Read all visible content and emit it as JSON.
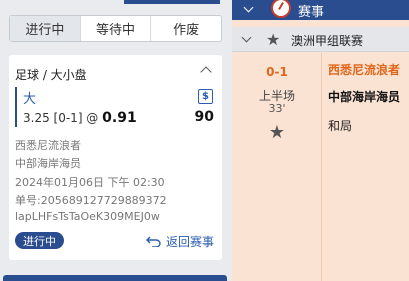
{
  "left_panel": {
    "tabs": [
      {
        "label": "进行中"
      },
      {
        "label": "等待中"
      },
      {
        "label": "作废"
      }
    ],
    "bet": {
      "market": "足球 / 大小盘",
      "selection": "大",
      "line": "3.25 [0-1] @",
      "odds": "0.91",
      "stake": "90",
      "home_team": "西悉尼流浪者",
      "away_team": "中部海岸海员",
      "datetime": "2024年01月06日 下午 02:30",
      "bet_no": "单号:205689127729889372",
      "ref_code": "lapLHFsTsTaOeK309MEJ0w",
      "status": "进行中",
      "back_label": "返回赛事"
    }
  },
  "right_panel": {
    "section_title": "赛事",
    "league": "澳洲甲组联赛",
    "match": {
      "score": "0-1",
      "period": "上半场",
      "minute": "33'",
      "home": "西悉尼流浪者",
      "away": "中部海岸海员",
      "draw": "和局"
    }
  },
  "colors": {
    "brand": "#2a4d8f",
    "accent": "#e0671c",
    "match_bg": "#fbe3d3",
    "panel_bg": "#e9ebee"
  },
  "icons": [
    "chevron-up-icon",
    "dollar-icon",
    "back-arrow-icon",
    "chevron-down-icon",
    "soccer-ball-icon",
    "star-icon"
  ]
}
